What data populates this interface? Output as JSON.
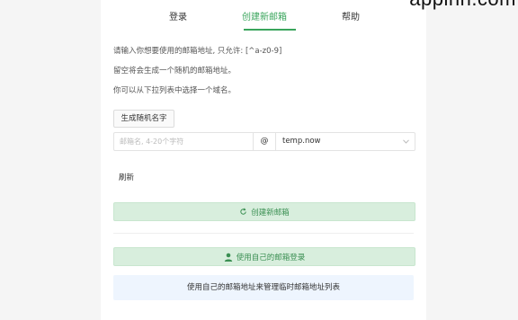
{
  "watermark": "appinn.com",
  "tabs": [
    {
      "label": "登录"
    },
    {
      "label": "创建新邮箱",
      "active": true
    },
    {
      "label": "帮助"
    }
  ],
  "info": {
    "line1": "请输入你想要使用的邮箱地址, 只允许: [^a-z0-9]",
    "line2": "留空将会生成一个随机的邮箱地址。",
    "line3": "你可以从下拉列表中选择一个域名。"
  },
  "form": {
    "random_name_button": "生成随机名字",
    "name_placeholder": "邮箱名, 4-20个字符",
    "name_value": "",
    "at_symbol": "@",
    "domain_selected": "temp.now",
    "refresh_link": "刷新",
    "create_button": "创建新邮箱"
  },
  "own": {
    "login_button": "使用自己的邮箱登录",
    "note": "使用自己的邮箱地址来管理临时邮箱地址列表"
  },
  "colors": {
    "accent": "#3aa55c",
    "button_bg": "#d8eedd",
    "note_bg": "#eef5fe"
  },
  "icons": {
    "create": "refresh-icon",
    "own": "user-icon",
    "select": "chevron-down-icon"
  }
}
